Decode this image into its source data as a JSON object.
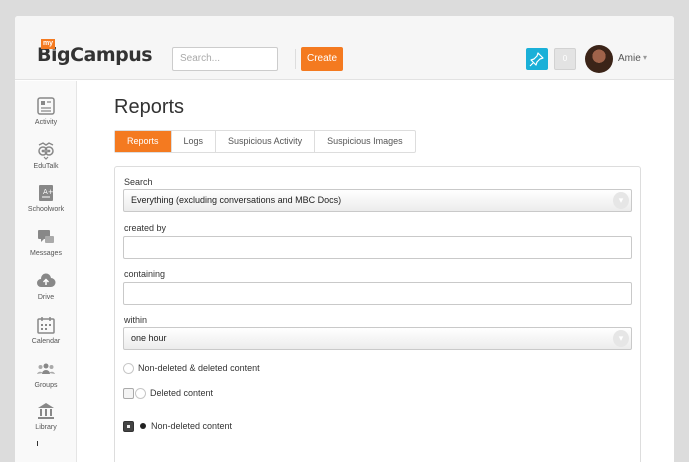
{
  "header": {
    "logo_my": "my",
    "logo_text": "BigCampus",
    "search_placeholder": "Search...",
    "create_label": "Create",
    "notif_count": "0",
    "username": "Amie",
    "pin_icon": "pushpin-icon",
    "user_caret": "▾",
    "accent_color": "#f47a20",
    "pin_color": "#1ab0d8"
  },
  "sidebar": {
    "items": [
      {
        "label": "Activity",
        "icon": "activity-icon"
      },
      {
        "label": "EduTalk",
        "icon": "owl-icon"
      },
      {
        "label": "Schoolwork",
        "icon": "grade-icon"
      },
      {
        "label": "Messages",
        "icon": "chat-icon"
      },
      {
        "label": "Drive",
        "icon": "cloud-upload-icon"
      },
      {
        "label": "Calendar",
        "icon": "calendar-icon"
      },
      {
        "label": "Groups",
        "icon": "groups-icon"
      },
      {
        "label": "Library",
        "icon": "library-icon"
      }
    ]
  },
  "main": {
    "title": "Reports",
    "tabs": [
      {
        "label": "Reports",
        "active": true
      },
      {
        "label": "Logs",
        "active": false
      },
      {
        "label": "Suspicious Activity",
        "active": false
      },
      {
        "label": "Suspicious Images",
        "active": false
      }
    ],
    "form": {
      "search_label": "Search",
      "search_value": "Everything (excluding conversations and MBC Docs)",
      "created_by_label": "created by",
      "created_by_value": "",
      "containing_label": "containing",
      "containing_value": "",
      "within_label": "within",
      "within_value": "one hour",
      "select_arrow": "▾",
      "options": [
        {
          "label": "Non-deleted & deleted content",
          "checked": false
        },
        {
          "label": "Deleted content",
          "checked": false
        },
        {
          "label": "Non-deleted content",
          "checked": true
        }
      ]
    }
  }
}
